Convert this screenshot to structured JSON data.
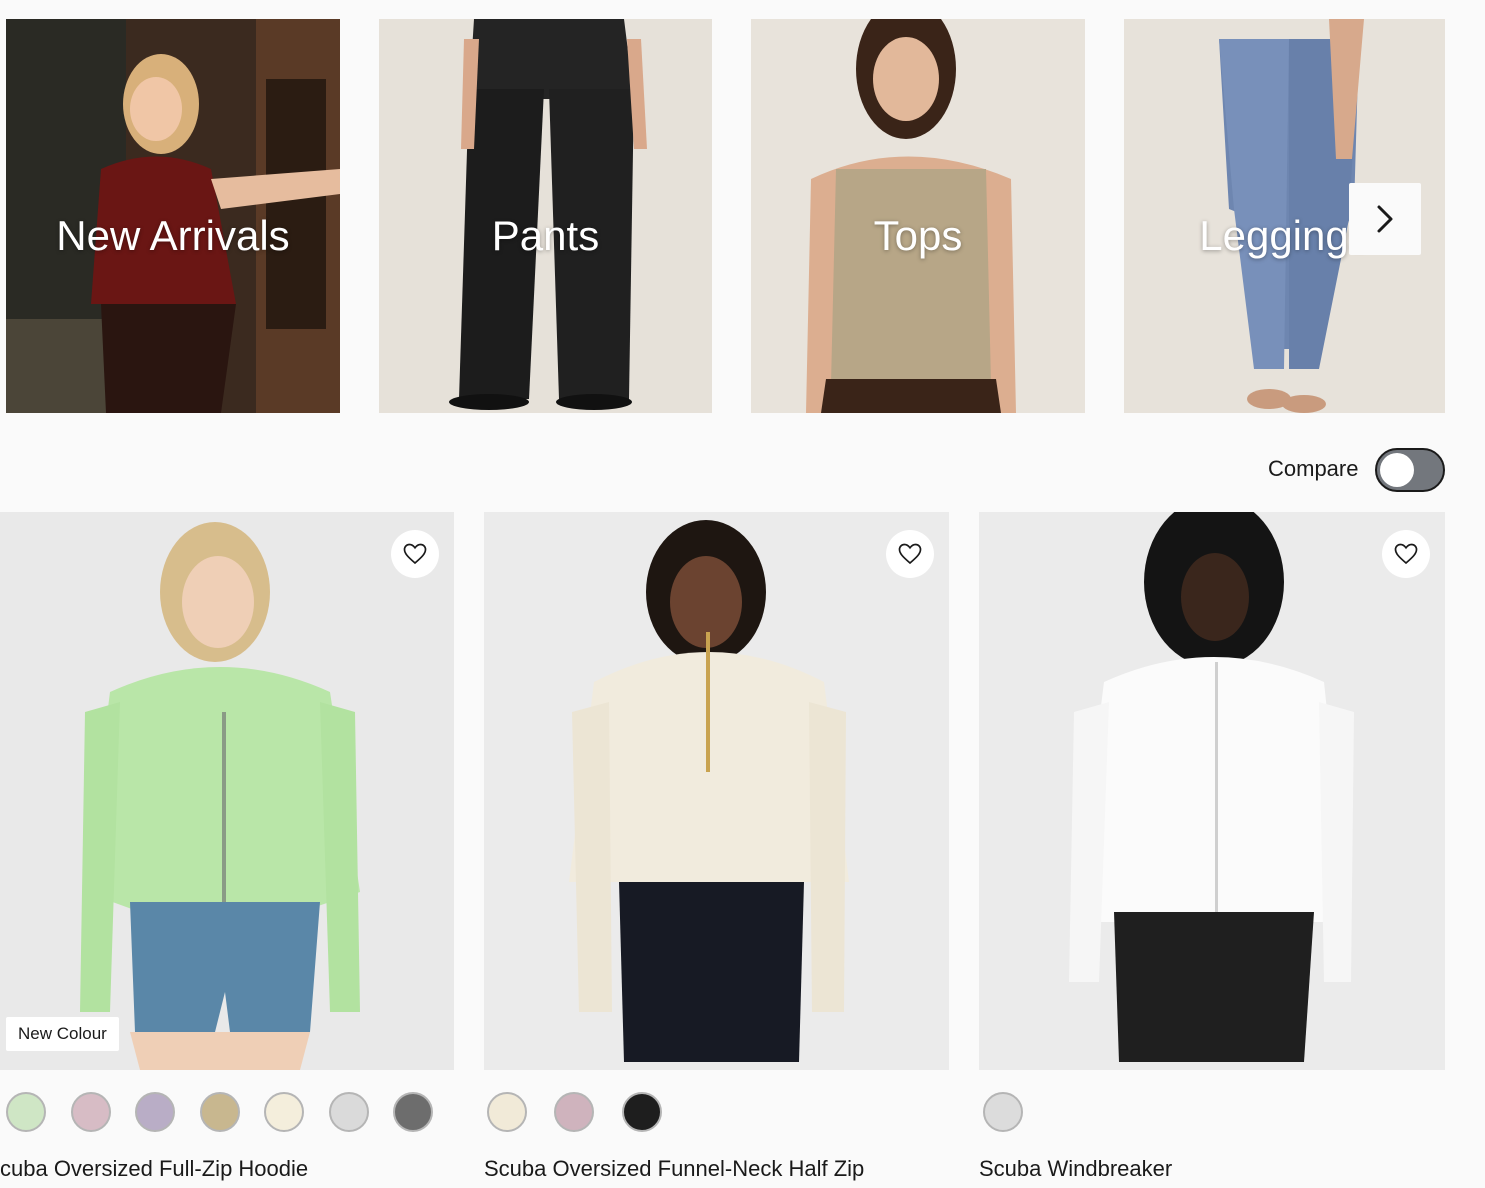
{
  "categories": [
    {
      "label": "New Arrivals"
    },
    {
      "label": "Pants"
    },
    {
      "label": "Tops"
    },
    {
      "label": "Leggings"
    }
  ],
  "compare": {
    "label": "Compare",
    "enabled": false
  },
  "products": [
    {
      "name": "cuba Oversized Full-Zip Hoodie",
      "badge": "New Colour",
      "swatches": [
        "#cfe6c5",
        "#d7bcc5",
        "#b9adc6",
        "#c8b78f",
        "#f4eedc",
        "#dadada",
        "#6d6d6d"
      ]
    },
    {
      "name": "Scuba Oversized Funnel-Neck Half Zip",
      "swatches": [
        "#f1ead8",
        "#cfb3bd",
        "#1e1e1e"
      ]
    },
    {
      "name": "Scuba Windbreaker",
      "swatches": [
        "#dcdcdc"
      ]
    }
  ],
  "icons": {
    "next": "chevron-right-icon",
    "favorite": "heart-icon"
  },
  "colors": {
    "background": "#fafafa",
    "text": "#1a1a1a",
    "toggle_off": "#73777d"
  }
}
